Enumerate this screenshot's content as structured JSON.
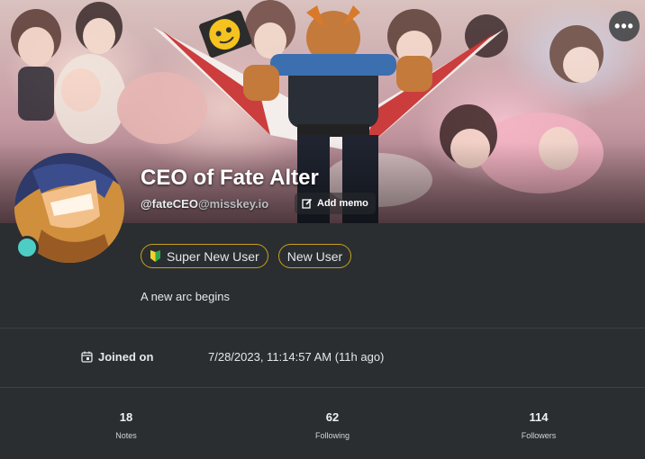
{
  "header": {
    "more_icon": "more-dots-icon",
    "more_label": "•••"
  },
  "profile": {
    "display_name": "CEO of Fate Alter",
    "username": "@fateCEO",
    "host": "@misskey.io",
    "memo_label": "Add memo",
    "memo_icon": "edit-icon",
    "status_color": "#4ecdc4",
    "bio": "A new arc begins"
  },
  "roles": [
    {
      "label": "Super New User",
      "icon": "beginner-leaf-icon"
    },
    {
      "label": "New User"
    }
  ],
  "fields": {
    "joined_label": "Joined on",
    "joined_icon": "calendar-icon",
    "joined_value": "7/28/2023, 11:14:57 AM (11h ago)"
  },
  "stats": [
    {
      "value": "18",
      "label": "Notes"
    },
    {
      "value": "62",
      "label": "Following"
    },
    {
      "value": "114",
      "label": "Followers"
    }
  ],
  "colors": {
    "background": "#2a2e30",
    "role_border": "#c8a11e",
    "accent": "#4ecdc4"
  }
}
